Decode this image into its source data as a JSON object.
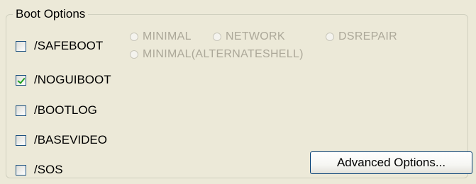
{
  "group": {
    "title": "Boot Options"
  },
  "checkboxes": [
    {
      "label": "/SAFEBOOT",
      "checked": false
    },
    {
      "label": "/NOGUIBOOT",
      "checked": true
    },
    {
      "label": "/BOOTLOG",
      "checked": false
    },
    {
      "label": "/BASEVIDEO",
      "checked": false
    },
    {
      "label": "/SOS",
      "checked": false
    }
  ],
  "safeboot_options": {
    "enabled": false,
    "items": [
      {
        "label": "MINIMAL",
        "selected": false
      },
      {
        "label": "NETWORK",
        "selected": false
      },
      {
        "label": "DSREPAIR",
        "selected": false
      },
      {
        "label": "MINIMAL(ALTERNATESHELL)",
        "selected": false
      }
    ]
  },
  "buttons": {
    "advanced_label": "Advanced Options..."
  },
  "colors": {
    "background": "#ece9d8",
    "disabled_text": "#aca899",
    "checkmark": "#21a121",
    "button_border": "#003c74"
  }
}
